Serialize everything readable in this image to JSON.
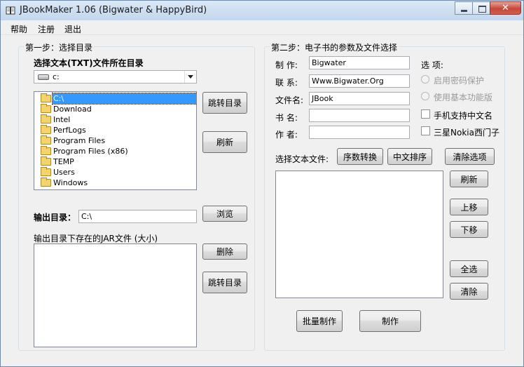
{
  "window": {
    "title": "JBookMaker 1.06 (Bigwater & HappyBird)"
  },
  "menu": [
    "帮助",
    "注册",
    "退出"
  ],
  "step1": {
    "title": "第一步：选择目录",
    "select_dir_label": "选择文本(TXT)文件所在目录",
    "drive": "c:",
    "dirs": [
      "C:\\",
      "Download",
      "Intel",
      "PerfLogs",
      "Program Files",
      "Program Files (x86)",
      "TEMP",
      "Users",
      "Windows"
    ],
    "jump_dir_btn": "跳转目录",
    "refresh_btn": "刷新",
    "output_label": "输出目录：",
    "output_value": "C:\\",
    "browse_btn": "浏览",
    "jar_label": "输出目录下存在的JAR文件 (大小)",
    "delete_btn": "删除",
    "jump_dir_btn2": "跳转目录"
  },
  "step2": {
    "title": "第二步：电子书的参数及文件选择",
    "maker_label": "制 作:",
    "maker_value": "Bigwater",
    "contact_label": "联 系:",
    "contact_value": "Www.Bigwater.Org",
    "filename_label": "文件名:",
    "filename_value": "JBook",
    "bookname_label": "书 名:",
    "bookname_value": "",
    "author_label": "作 者:",
    "author_value": "",
    "options_label": "选 项:",
    "opt_password": "启用密码保护",
    "opt_basic": "使用基本功能版",
    "opt_chinese_name": "手机支持中文名",
    "opt_samsung": "三星Nokia西门子",
    "select_files_label": "选择文本文件:",
    "seq_convert_btn": "序数转换",
    "cn_sort_btn": "中文排序",
    "clear_sel_btn": "清除选项",
    "refresh_btn": "刷新",
    "up_btn": "上移",
    "down_btn": "下移",
    "select_all_btn": "全选",
    "clear_btn": "清除",
    "batch_btn": "批量制作",
    "make_btn": "制作"
  }
}
